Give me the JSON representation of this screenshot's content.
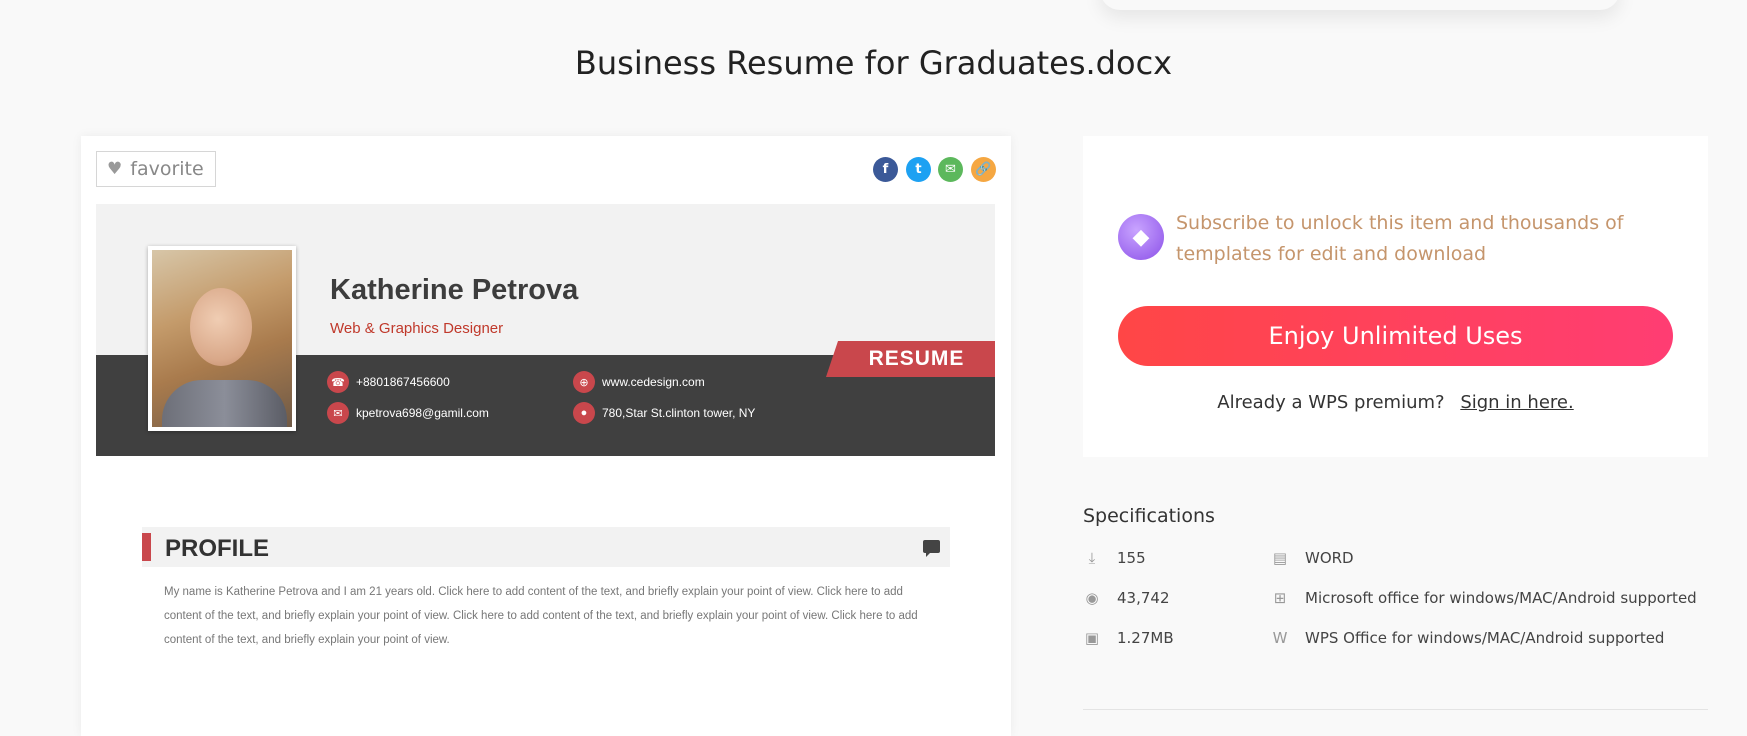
{
  "page": {
    "title": "Business Resume for Graduates.docx"
  },
  "preview": {
    "favorite_label": "favorite",
    "share": {
      "facebook": "f",
      "twitter": "t",
      "email": "✉",
      "link": "🔗"
    },
    "resume": {
      "name": "Katherine Petrova",
      "role": "Web & Graphics Designer",
      "tag": "RESUME",
      "phone": "+8801867456600",
      "website": "www.cedesign.com",
      "email": "kpetrova698@gamil.com",
      "address": "780,Star St.clinton tower, NY",
      "profile_title": "PROFILE",
      "profile_text": "My name is Katherine Petrova and I am 21 years old. Click here to add content of the text, and briefly explain your point of view. Click here to add content of the text, and briefly explain your point of view. Click here to add content of the text, and briefly explain your point of view. Click here to add content of the text, and briefly explain your point of view."
    }
  },
  "panel": {
    "subscribe_text": "Subscribe to unlock this item and thousands of templates for edit and download",
    "cta_label": "Enjoy Unlimited Uses",
    "already_text": "Already a WPS premium?",
    "signin_label": "Sign in here."
  },
  "specs": {
    "title": "Specifications",
    "downloads": "155",
    "views": "43,742",
    "size": "1.27MB",
    "format": "WORD",
    "ms_support": "Microsoft office for windows/MAC/Android supported",
    "wps_support": "WPS Office for windows/MAC/Android supported"
  },
  "colors": {
    "accent": "#c9474c",
    "cta_start": "#ff4646",
    "cta_end": "#ff3d73",
    "subscribe": "#c5956c"
  }
}
